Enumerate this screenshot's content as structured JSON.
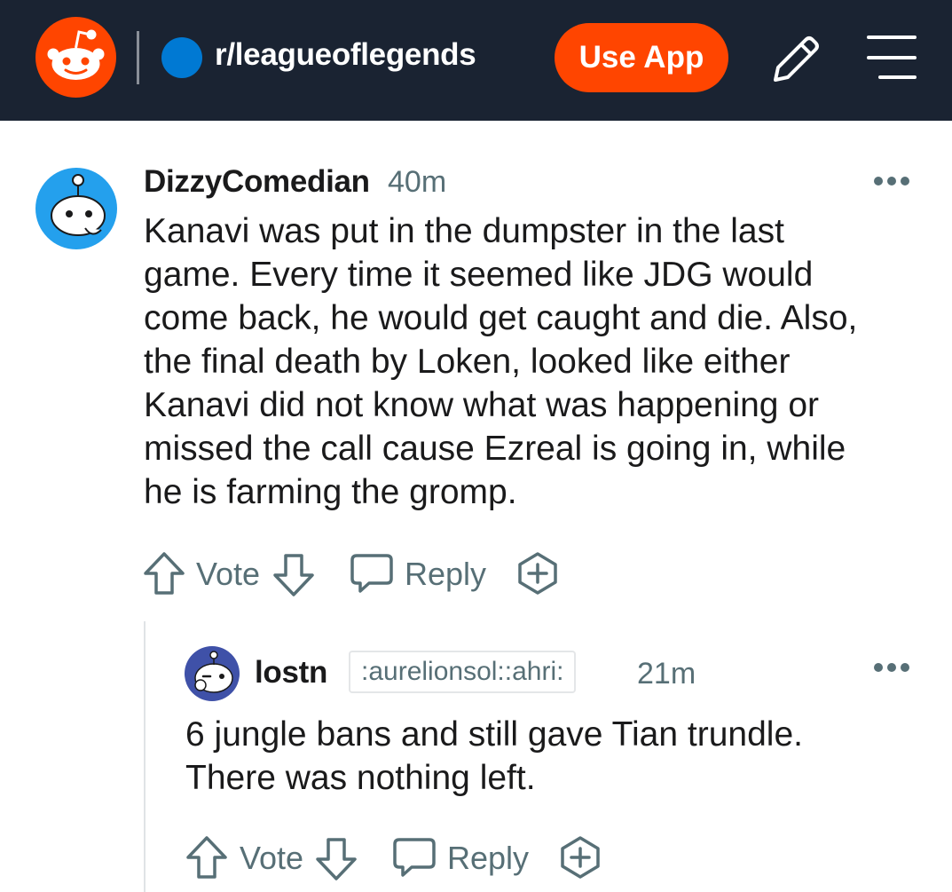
{
  "header": {
    "subreddit": "r/leagueoflegends",
    "use_app_label": "Use App",
    "colors": {
      "bg": "#1a2332",
      "accent": "#ff4500",
      "sub_icon": "#0079d3"
    }
  },
  "comments": [
    {
      "author": "DizzyComedian",
      "time": "40m",
      "flair": "",
      "body_lines": [
        "Kanavi was put in the dumpster in the last",
        "game. Every time it seemed like JDG would",
        "come back, he would get caught and die. Also,",
        "the final death by Loken, looked like either",
        "Kanavi did not know what was happening or",
        "missed the call cause Ezreal is going in, while",
        "he is farming the gromp."
      ],
      "vote_label": "Vote",
      "reply_label": "Reply",
      "avatar_color": "#24a0ed"
    },
    {
      "author": "lostn",
      "time": "21m",
      "flair": ":aurelionsol::ahri:",
      "body_lines": [
        "6 jungle bans and still gave Tian trundle.",
        "There was nothing left."
      ],
      "vote_label": "Vote",
      "reply_label": "Reply",
      "avatar_color": "#3f51a8"
    }
  ]
}
